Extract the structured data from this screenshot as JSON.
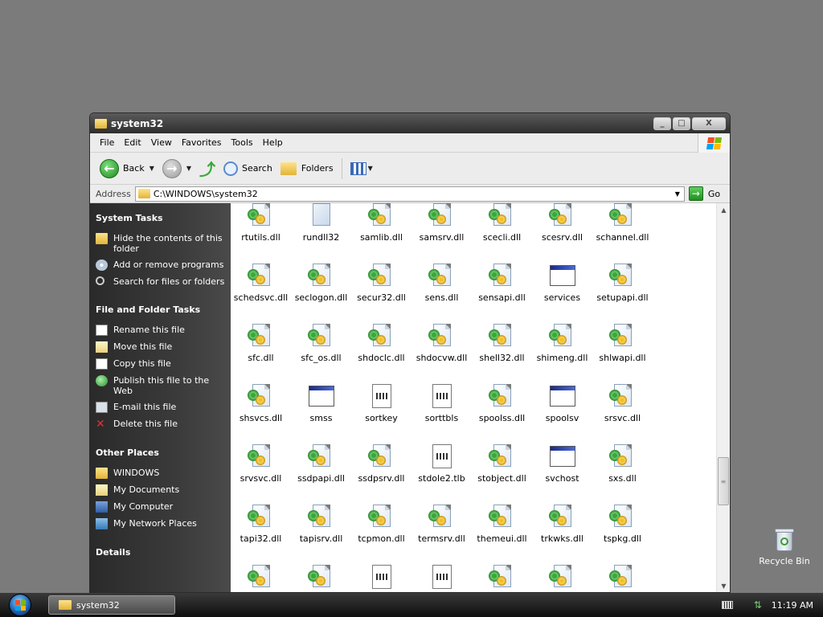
{
  "window": {
    "title": "system32",
    "minimize": "_",
    "maximize": "□",
    "close": "X"
  },
  "menu": [
    "File",
    "Edit",
    "View",
    "Favorites",
    "Tools",
    "Help"
  ],
  "toolbar": {
    "back": "Back",
    "search": "Search",
    "folders": "Folders"
  },
  "address": {
    "label": "Address",
    "value": "C:\\WINDOWS\\system32",
    "go": "Go"
  },
  "taskpane": {
    "system_tasks": {
      "title": "System Tasks",
      "items": [
        "Hide the contents of this folder",
        "Add or remove programs",
        "Search for files or folders"
      ]
    },
    "file_tasks": {
      "title": "File and Folder Tasks",
      "items": [
        "Rename this file",
        "Move this file",
        "Copy this file",
        "Publish this file to the Web",
        "E-mail this file",
        "Delete this file"
      ]
    },
    "other_places": {
      "title": "Other Places",
      "items": [
        "WINDOWS",
        "My Documents",
        "My Computer",
        "My Network Places"
      ]
    },
    "details": {
      "title": "Details"
    }
  },
  "files": [
    {
      "name": "rtutils.dll",
      "type": "dll"
    },
    {
      "name": "rundll32",
      "type": "blank"
    },
    {
      "name": "samlib.dll",
      "type": "dll"
    },
    {
      "name": "samsrv.dll",
      "type": "dll"
    },
    {
      "name": "scecli.dll",
      "type": "dll"
    },
    {
      "name": "scesrv.dll",
      "type": "dll"
    },
    {
      "name": "schannel.dll",
      "type": "dll"
    },
    {
      "name": "schedsvc.dll",
      "type": "dll"
    },
    {
      "name": "seclogon.dll",
      "type": "dll"
    },
    {
      "name": "secur32.dll",
      "type": "dll"
    },
    {
      "name": "sens.dll",
      "type": "dll"
    },
    {
      "name": "sensapi.dll",
      "type": "dll"
    },
    {
      "name": "services",
      "type": "exe"
    },
    {
      "name": "setupapi.dll",
      "type": "dll"
    },
    {
      "name": "sfc.dll",
      "type": "dll"
    },
    {
      "name": "sfc_os.dll",
      "type": "dll"
    },
    {
      "name": "shdoclc.dll",
      "type": "dll"
    },
    {
      "name": "shdocvw.dll",
      "type": "dll"
    },
    {
      "name": "shell32.dll",
      "type": "dll"
    },
    {
      "name": "shimeng.dll",
      "type": "dll"
    },
    {
      "name": "shlwapi.dll",
      "type": "dll"
    },
    {
      "name": "shsvcs.dll",
      "type": "dll"
    },
    {
      "name": "smss",
      "type": "exe"
    },
    {
      "name": "sortkey",
      "type": "nls"
    },
    {
      "name": "sorttbls",
      "type": "nls"
    },
    {
      "name": "spoolss.dll",
      "type": "dll"
    },
    {
      "name": "spoolsv",
      "type": "exe"
    },
    {
      "name": "srsvc.dll",
      "type": "dll"
    },
    {
      "name": "srvsvc.dll",
      "type": "dll"
    },
    {
      "name": "ssdpapi.dll",
      "type": "dll"
    },
    {
      "name": "ssdpsrv.dll",
      "type": "dll"
    },
    {
      "name": "stdole2.tlb",
      "type": "nls"
    },
    {
      "name": "stobject.dll",
      "type": "dll"
    },
    {
      "name": "svchost",
      "type": "exe"
    },
    {
      "name": "sxs.dll",
      "type": "dll"
    },
    {
      "name": "tapi32.dll",
      "type": "dll"
    },
    {
      "name": "tapisrv.dll",
      "type": "dll"
    },
    {
      "name": "tcpmon.dll",
      "type": "dll"
    },
    {
      "name": "termsrv.dll",
      "type": "dll"
    },
    {
      "name": "themeui.dll",
      "type": "dll"
    },
    {
      "name": "trkwks.dll",
      "type": "dll"
    },
    {
      "name": "tspkg.dll",
      "type": "dll"
    },
    {
      "name": "",
      "type": "dll"
    },
    {
      "name": "",
      "type": "dll"
    },
    {
      "name": "",
      "type": "nls"
    },
    {
      "name": "",
      "type": "nls"
    },
    {
      "name": "",
      "type": "dll"
    },
    {
      "name": "",
      "type": "dll"
    },
    {
      "name": "",
      "type": "dll"
    }
  ],
  "desktop": {
    "recycle_bin": "Recycle Bin"
  },
  "taskbar": {
    "window_button": "system32",
    "time": "11:19 AM"
  },
  "colors": {
    "desktop": "#7b7b7b",
    "taskpane": "#333333",
    "accent_green": "#1e8a1e"
  }
}
